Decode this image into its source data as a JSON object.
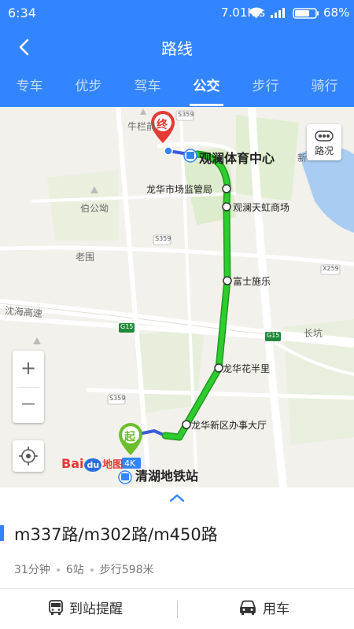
{
  "status_bar": {
    "time": "6:34",
    "network_speed": "7.01K/s",
    "battery_percent": "68%",
    "icons": [
      "wifi-icon",
      "signal-icon",
      "battery-icon"
    ]
  },
  "header": {
    "title": "路线",
    "back_icon": "back-arrow-icon"
  },
  "tabs": [
    {
      "label": "专车",
      "active": false
    },
    {
      "label": "优步",
      "active": false
    },
    {
      "label": "驾车",
      "active": false
    },
    {
      "label": "公交",
      "active": true
    },
    {
      "label": "步行",
      "active": false
    },
    {
      "label": "骑行",
      "active": false
    }
  ],
  "map": {
    "end_marker": "终",
    "start_marker": "起",
    "start_badge": "4K",
    "destination_label": "观澜体育中心",
    "origin_label": "清湖地铁站",
    "stops": [
      "龙华市场监管局",
      "观澜天虹商场",
      "富士施乐",
      "龙华花半里",
      "龙华新区办事大厅"
    ],
    "place_labels": [
      "牛栏前",
      "伯公坳",
      "老围",
      "沈海高速",
      "长坑",
      "新"
    ],
    "road_badges": [
      "S359",
      "S359",
      "S359",
      "G15",
      "G15",
      "X259",
      "S359"
    ],
    "traffic_button_label": "路况",
    "zoom_in": "+",
    "zoom_out": "—",
    "logo": {
      "bai": "Bai",
      "du": "du",
      "ditu": "地图"
    },
    "colors": {
      "route": "#2ecc2e",
      "route_outline": "#1e9a1e",
      "walk": "#3b5bdb",
      "end_marker": "#e53935",
      "start_marker": "#6abf2a"
    }
  },
  "panel": {
    "route_name": "m337路/m302路/m450路",
    "duration": "31分钟",
    "stops_count": "6站",
    "walk": "步行598米",
    "actions": [
      {
        "label": "到站提醒",
        "icon": "bus-icon"
      },
      {
        "label": "用车",
        "icon": "car-icon"
      }
    ]
  },
  "accent_color": "#3385ff"
}
